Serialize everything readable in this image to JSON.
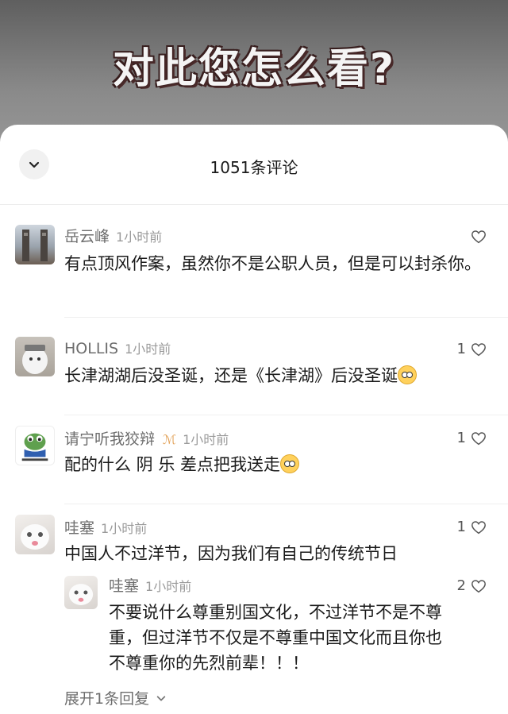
{
  "video": {
    "caption": "对此您怎么看?"
  },
  "header": {
    "count_label": "1051条评论"
  },
  "comments": [
    {
      "name": "岳云峰",
      "time": "1小时前",
      "text": "有点顶风作案，虽然你不是公职人员，但是可以封杀你。",
      "likes": ""
    },
    {
      "name": "HOLLIS",
      "time": "1小时前",
      "text": "长津湖湖后没圣诞，还是《长津湖》后没圣诞",
      "likes": "1"
    },
    {
      "name": "请宁听我狡辩",
      "time": "1小时前",
      "text": "配的什么 阴 乐 差点把我送走",
      "likes": "1",
      "badge": "ℳ"
    },
    {
      "name": "哇塞",
      "time": "1小时前",
      "text": "中国人不过洋节，因为我们有自己的传统节日",
      "likes": "1"
    }
  ],
  "reply": {
    "name": "哇塞",
    "time": "1小时前",
    "text": "不要说什么尊重别国文化，不过洋节不是不尊重，但过洋节不仅是不尊重中国文化而且你也不尊重你的先烈前辈！！！",
    "likes": "2"
  },
  "expand_label": "展开1条回复",
  "icons": {
    "collapse": "chevron-down-icon",
    "like": "heart-outline-icon",
    "emoji_smile": "smile-emoji-icon",
    "emoji_sweat": "sweat-emoji-icon"
  },
  "colors": {
    "name": "#6d6d6d",
    "time": "#9a9a9a",
    "text": "#1a1a1a"
  }
}
